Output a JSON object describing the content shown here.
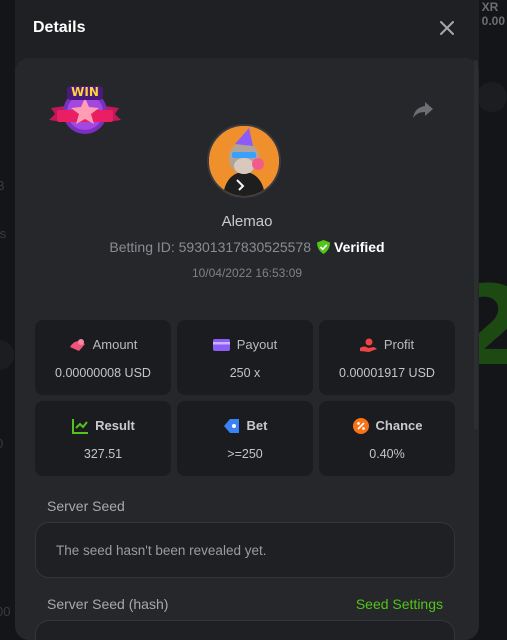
{
  "background": {
    "left_fragments": [
      "B",
      "ts",
      "0",
      "00"
    ],
    "top_right_text": "XR",
    "top_right_sub": "0.00",
    "big_number": "2"
  },
  "modal": {
    "title": "Details",
    "close_icon": "close-icon",
    "share_icon": "share-icon",
    "badge_text": "WIN",
    "player": {
      "username": "Alemao",
      "betting_id": "Betting ID: 59301317830525578",
      "verified_label": "Verified",
      "timestamp": "10/04/2022 16:53:09"
    },
    "stats": [
      {
        "key": "amount",
        "label": "Amount",
        "value": "0.00000008 USD",
        "icon": "coins-icon",
        "color": "#f0537a"
      },
      {
        "key": "payout",
        "label": "Payout",
        "value": "250 x",
        "icon": "wallet-icon",
        "color": "#8b5cf6"
      },
      {
        "key": "profit",
        "label": "Profit",
        "value": "0.00001917 USD",
        "icon": "hand-coin-icon",
        "color": "#ef4444"
      },
      {
        "key": "result",
        "label": "Result",
        "value": "327.51",
        "icon": "chart-check-icon",
        "color": "#52c41a"
      },
      {
        "key": "bet",
        "label": "Bet",
        "value": ">=250",
        "icon": "tag-icon",
        "color": "#3b82f6"
      },
      {
        "key": "chance",
        "label": "Chance",
        "value": "0.40%",
        "icon": "percent-icon",
        "color": "#f97316"
      }
    ],
    "server_seed": {
      "label": "Server Seed",
      "value": "The seed hasn't been revealed yet."
    },
    "server_seed_hash": {
      "label": "Server Seed (hash)",
      "settings_link": "Seed Settings"
    },
    "colors": {
      "accent_green": "#52c41a",
      "modal_bg": "#1f2023",
      "card_bg": "#26272b"
    }
  }
}
